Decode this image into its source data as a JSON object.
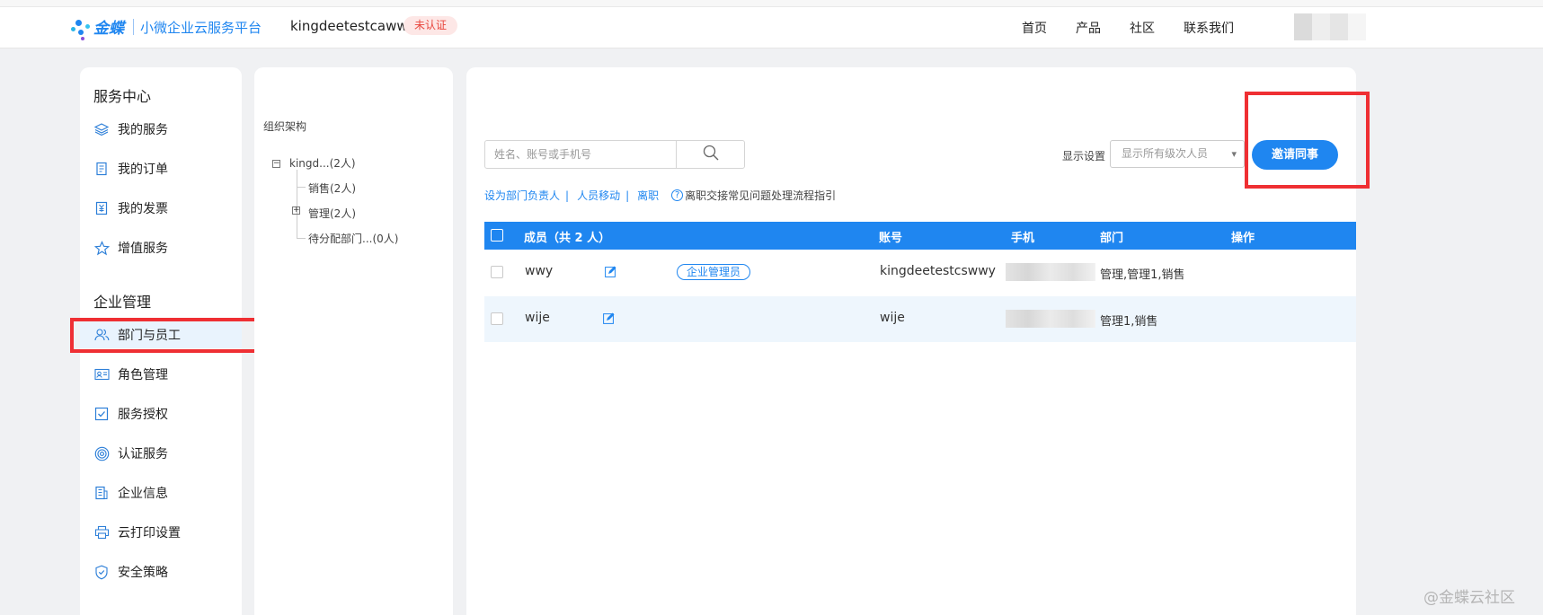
{
  "header": {
    "logo_name": "金蝶",
    "platform": "小微企业云服务平台",
    "company": "kingdeetestcawwy",
    "status_badge": "未认证",
    "nav": [
      "首页",
      "产品",
      "社区",
      "联系我们"
    ]
  },
  "sidebar": {
    "section1": "服务中心",
    "items1": [
      {
        "label": "我的服务",
        "icon": "layers-icon"
      },
      {
        "label": "我的订单",
        "icon": "document-icon"
      },
      {
        "label": "我的发票",
        "icon": "invoice-icon"
      },
      {
        "label": "增值服务",
        "icon": "star-icon"
      }
    ],
    "section2": "企业管理",
    "items2": [
      {
        "label": "部门与员工",
        "icon": "users-icon",
        "active": true
      },
      {
        "label": "角色管理",
        "icon": "id-card-icon"
      },
      {
        "label": "服务授权",
        "icon": "checkbox-icon"
      },
      {
        "label": "认证服务",
        "icon": "target-icon"
      },
      {
        "label": "企业信息",
        "icon": "building-icon"
      },
      {
        "label": "云打印设置",
        "icon": "printer-icon"
      },
      {
        "label": "安全策略",
        "icon": "shield-icon"
      }
    ]
  },
  "org": {
    "title": "组织架构",
    "root": "kingd...(2人)",
    "children": [
      "销售(2人)",
      "管理(2人)",
      "待分配部门...(0人)"
    ]
  },
  "main": {
    "search_placeholder": "姓名、账号或手机号",
    "display_label": "显示设置",
    "display_select": "显示所有级次人员",
    "invite_button": "邀请同事",
    "actions": [
      "设为部门负责人",
      "人员移动",
      "离职"
    ],
    "help_text": "离职交接常见问题处理流程指引",
    "columns": {
      "member": "成员（共 2 人）",
      "account": "账号",
      "phone": "手机",
      "dept": "部门",
      "ops": "操作"
    },
    "rows": [
      {
        "name": "wwy",
        "tag": "企业管理员",
        "account": "kingdeetestcswwy",
        "dept": "管理,管理1,销售"
      },
      {
        "name": "wije",
        "tag": "",
        "account": "wije",
        "dept": "管理1,销售"
      }
    ]
  },
  "watermark": "@金蝶云社区",
  "colors": {
    "accent": "#1f86f0",
    "highlight_box": "#ef2f33",
    "badge_red": "#e8453c"
  }
}
